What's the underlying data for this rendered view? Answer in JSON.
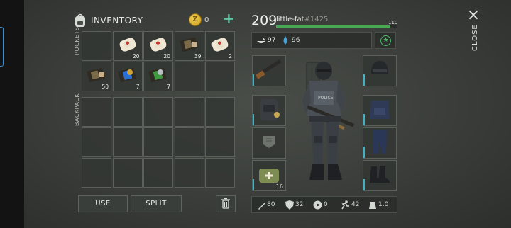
{
  "inventory": {
    "title": "INVENTORY",
    "coins": "0",
    "coin_symbol": "Z",
    "add_label": "+",
    "pockets_label": "POCKETS",
    "backpack_label": "BACKPACK",
    "pockets": [
      {
        "item": "empty",
        "qty": ""
      },
      {
        "item": "bandage",
        "qty": "20"
      },
      {
        "item": "bandage",
        "qty": "20"
      },
      {
        "item": "military-pouch",
        "qty": "39"
      },
      {
        "item": "bandage",
        "qty": "2"
      },
      {
        "item": "military-pouch",
        "qty": "50"
      },
      {
        "item": "blue-badge-pouch",
        "qty": "7"
      },
      {
        "item": "green-badge-pouch",
        "qty": "7"
      },
      {
        "item": "empty",
        "qty": ""
      },
      {
        "item": "empty",
        "qty": ""
      }
    ],
    "use_label": "USE",
    "split_label": "SPLIT"
  },
  "player": {
    "level": "209",
    "name": "little-fat",
    "id": "#1425",
    "xp_max": "110",
    "xp_fraction": 0.94,
    "food": "97",
    "water": "96",
    "equipment_left": [
      {
        "item": "shotgun",
        "qty": ""
      },
      {
        "item": "tactical-backpack",
        "qty": ""
      },
      {
        "item": "armor-slot-empty",
        "qty": ""
      },
      {
        "item": "medical-kit-bag",
        "qty": "16"
      }
    ],
    "equipment_right": [
      {
        "item": "swat-helmet",
        "qty": ""
      },
      {
        "item": "swat-vest",
        "qty": ""
      },
      {
        "item": "swat-pants",
        "qty": ""
      },
      {
        "item": "swat-boots",
        "qty": ""
      }
    ],
    "stats": {
      "damage": "80",
      "armor": "32",
      "radiation": "0",
      "speed": "42",
      "weight": "1.0"
    }
  },
  "close_label": "CLOSE",
  "close_icon": "×",
  "colors": {
    "accent": "#5fc7a7",
    "xp": "#49a854",
    "slot_accent": "#3fb3c4"
  }
}
